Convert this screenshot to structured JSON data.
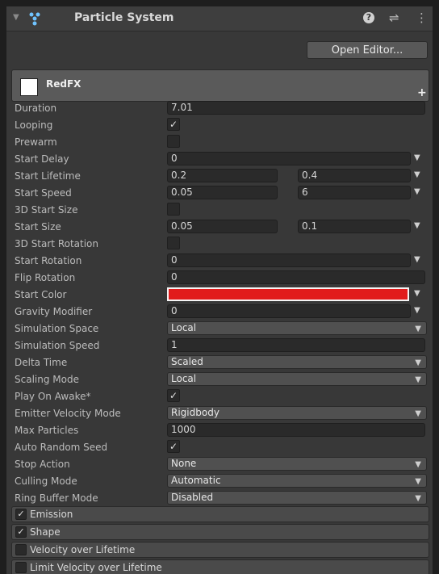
{
  "header": {
    "title": "Particle System",
    "help": "?",
    "presets": "⇌",
    "menu": "⋮"
  },
  "open_editor_label": "Open Editor...",
  "module": {
    "name": "RedFX",
    "add": "+"
  },
  "colors": {
    "start_color": "#e11c1c"
  },
  "props": {
    "duration": {
      "label": "Duration",
      "value": "7.01"
    },
    "looping": {
      "label": "Looping",
      "checked": "✓"
    },
    "prewarm": {
      "label": "Prewarm"
    },
    "start_delay": {
      "label": "Start Delay",
      "value": "0"
    },
    "start_lifetime": {
      "label": "Start Lifetime",
      "min": "0.2",
      "max": "0.4"
    },
    "start_speed": {
      "label": "Start Speed",
      "min": "0.05",
      "max": "6"
    },
    "start_size_3d": {
      "label": "3D Start Size"
    },
    "start_size": {
      "label": "Start Size",
      "min": "0.05",
      "max": "0.1"
    },
    "start_rotation_3d": {
      "label": "3D Start Rotation"
    },
    "start_rotation": {
      "label": "Start Rotation",
      "value": "0"
    },
    "flip_rotation": {
      "label": "Flip Rotation",
      "value": "0"
    },
    "start_color": {
      "label": "Start Color"
    },
    "gravity_modifier": {
      "label": "Gravity Modifier",
      "value": "0"
    },
    "simulation_space": {
      "label": "Simulation Space",
      "value": "Local"
    },
    "simulation_speed": {
      "label": "Simulation Speed",
      "value": "1"
    },
    "delta_time": {
      "label": "Delta Time",
      "value": "Scaled"
    },
    "scaling_mode": {
      "label": "Scaling Mode",
      "value": "Local"
    },
    "play_on_awake": {
      "label": "Play On Awake*",
      "checked": "✓"
    },
    "emitter_velocity_mode": {
      "label": "Emitter Velocity Mode",
      "value": "Rigidbody"
    },
    "max_particles": {
      "label": "Max Particles",
      "value": "1000"
    },
    "auto_random_seed": {
      "label": "Auto Random Seed",
      "checked": "✓"
    },
    "stop_action": {
      "label": "Stop Action",
      "value": "None"
    },
    "culling_mode": {
      "label": "Culling Mode",
      "value": "Automatic"
    },
    "ring_buffer_mode": {
      "label": "Ring Buffer Mode",
      "value": "Disabled"
    }
  },
  "modules": [
    {
      "label": "Emission",
      "checked": "✓"
    },
    {
      "label": "Shape",
      "checked": "✓"
    },
    {
      "label": "Velocity over Lifetime",
      "checked": ""
    },
    {
      "label": "Limit Velocity over Lifetime",
      "checked": ""
    }
  ]
}
